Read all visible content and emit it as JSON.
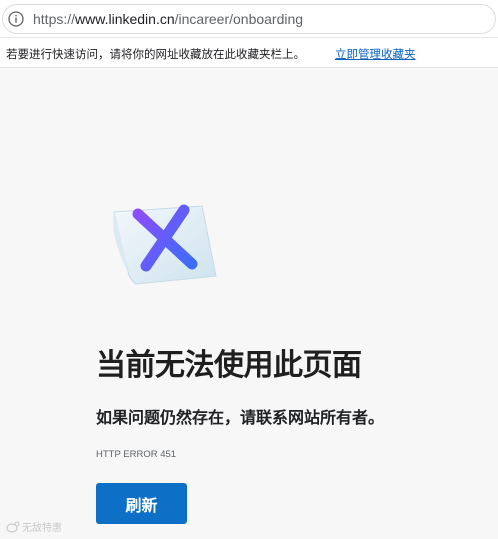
{
  "address_bar": {
    "url_prefix": "https://",
    "url_main": "www.linkedin.cn",
    "url_path": "/incareer/onboarding"
  },
  "favorites_bar": {
    "message": "若要进行快速访问，请将你的网址收藏放在此收藏夹栏上。",
    "link_label": "立即管理收藏夹"
  },
  "error_page": {
    "title": "当前无法使用此页面",
    "subtitle": "如果问题仍然存在，请联系网站所有者。",
    "error_code": "HTTP ERROR 451",
    "refresh_label": "刷新"
  },
  "watermark": {
    "text": "无敌特惠"
  },
  "colors": {
    "accent_button": "#0e6fc6",
    "link": "#0a62c4",
    "x_gradient_start": "#8a4dff",
    "x_gradient_end": "#3b6df5"
  }
}
